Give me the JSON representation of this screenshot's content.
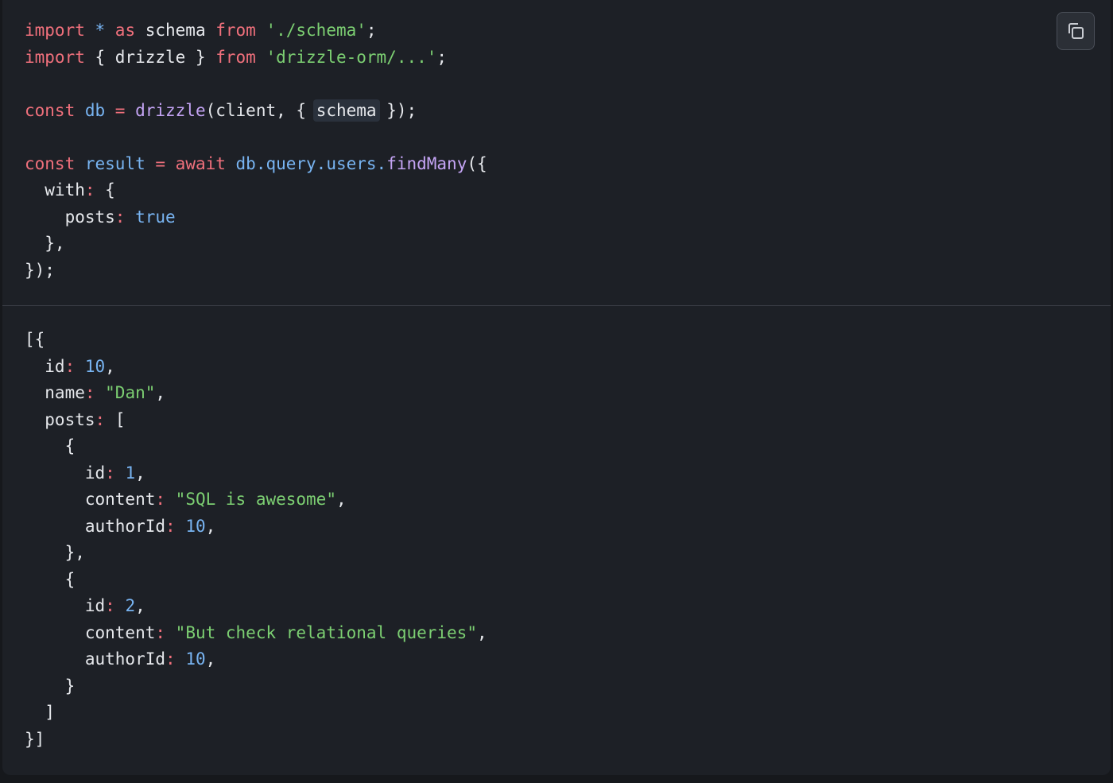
{
  "toolbar": {
    "copy_icon": "copy-icon"
  },
  "query_code": {
    "line1": {
      "import": "import",
      "star": " * ",
      "as": "as",
      "name": " schema ",
      "from": "from",
      "path": " './schema'",
      "end": ";"
    },
    "line2": {
      "import": "import",
      "brace": " { drizzle } ",
      "from": "from",
      "path": " 'drizzle-orm/...'",
      "end": ";"
    },
    "line4": {
      "const": "const",
      "db": " db",
      "eq": " = ",
      "fn": "drizzle",
      "args": "(client, { ",
      "schema": "schema",
      "end": " });"
    },
    "line6": {
      "const": "const",
      "result": " result",
      "eq": " = ",
      "await": "await",
      "chain": " db.query.users.",
      "fn": "findMany",
      "end": "({"
    },
    "line7": {
      "key": "  with",
      "colon": ":",
      "rest": " {"
    },
    "line8": {
      "key": "    posts",
      "colon": ":",
      "val": " true"
    },
    "line9": "  },",
    "line10": "});"
  },
  "result_output": {
    "open": "[{",
    "id": {
      "key": "  id",
      "colon": ":",
      "val": " 10",
      "end": ","
    },
    "name": {
      "key": "  name",
      "colon": ":",
      "val": " \"Dan\"",
      "end": ","
    },
    "posts": {
      "key": "  posts",
      "colon": ":",
      "rest": " ["
    },
    "post1": {
      "open": "    {",
      "id": {
        "key": "      id",
        "colon": ":",
        "val": " 1",
        "end": ","
      },
      "content": {
        "key": "      content",
        "colon": ":",
        "val": " \"SQL is awesome\"",
        "end": ","
      },
      "authorId": {
        "key": "      authorId",
        "colon": ":",
        "val": " 10",
        "end": ","
      },
      "close": "    },"
    },
    "post2": {
      "open": "    {",
      "id": {
        "key": "      id",
        "colon": ":",
        "val": " 2",
        "end": ","
      },
      "content": {
        "key": "      content",
        "colon": ":",
        "val": " \"But check relational queries\"",
        "end": ","
      },
      "authorId": {
        "key": "      authorId",
        "colon": ":",
        "val": " 10",
        "end": ","
      },
      "close": "    }"
    },
    "posts_close": "  ]",
    "close": "}]"
  }
}
